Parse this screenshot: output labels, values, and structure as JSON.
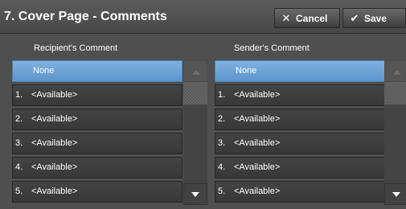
{
  "header": {
    "title": "7. Cover Page - Comments",
    "cancel_label": "Cancel",
    "save_label": "Save",
    "cancel_icon": "x-icon",
    "save_icon": "checkmark-icon"
  },
  "recipient": {
    "heading": "Recipient's Comment",
    "items": [
      {
        "num": "",
        "label": "None",
        "selected": true
      },
      {
        "num": "1.",
        "label": "<Available>"
      },
      {
        "num": "2.",
        "label": "<Available>"
      },
      {
        "num": "3.",
        "label": "<Available>"
      },
      {
        "num": "4.",
        "label": "<Available>"
      },
      {
        "num": "5.",
        "label": "<Available>"
      }
    ]
  },
  "sender": {
    "heading": "Sender's Comment",
    "items": [
      {
        "num": "",
        "label": "None",
        "selected": true
      },
      {
        "num": "1.",
        "label": "<Available>"
      },
      {
        "num": "2.",
        "label": "<Available>"
      },
      {
        "num": "3.",
        "label": "<Available>"
      },
      {
        "num": "4.",
        "label": "<Available>"
      },
      {
        "num": "5.",
        "label": "<Available>"
      }
    ]
  },
  "colors": {
    "background": "#4f4f4f",
    "selected": "#6ea3d6",
    "item": "#3e3e3e"
  }
}
